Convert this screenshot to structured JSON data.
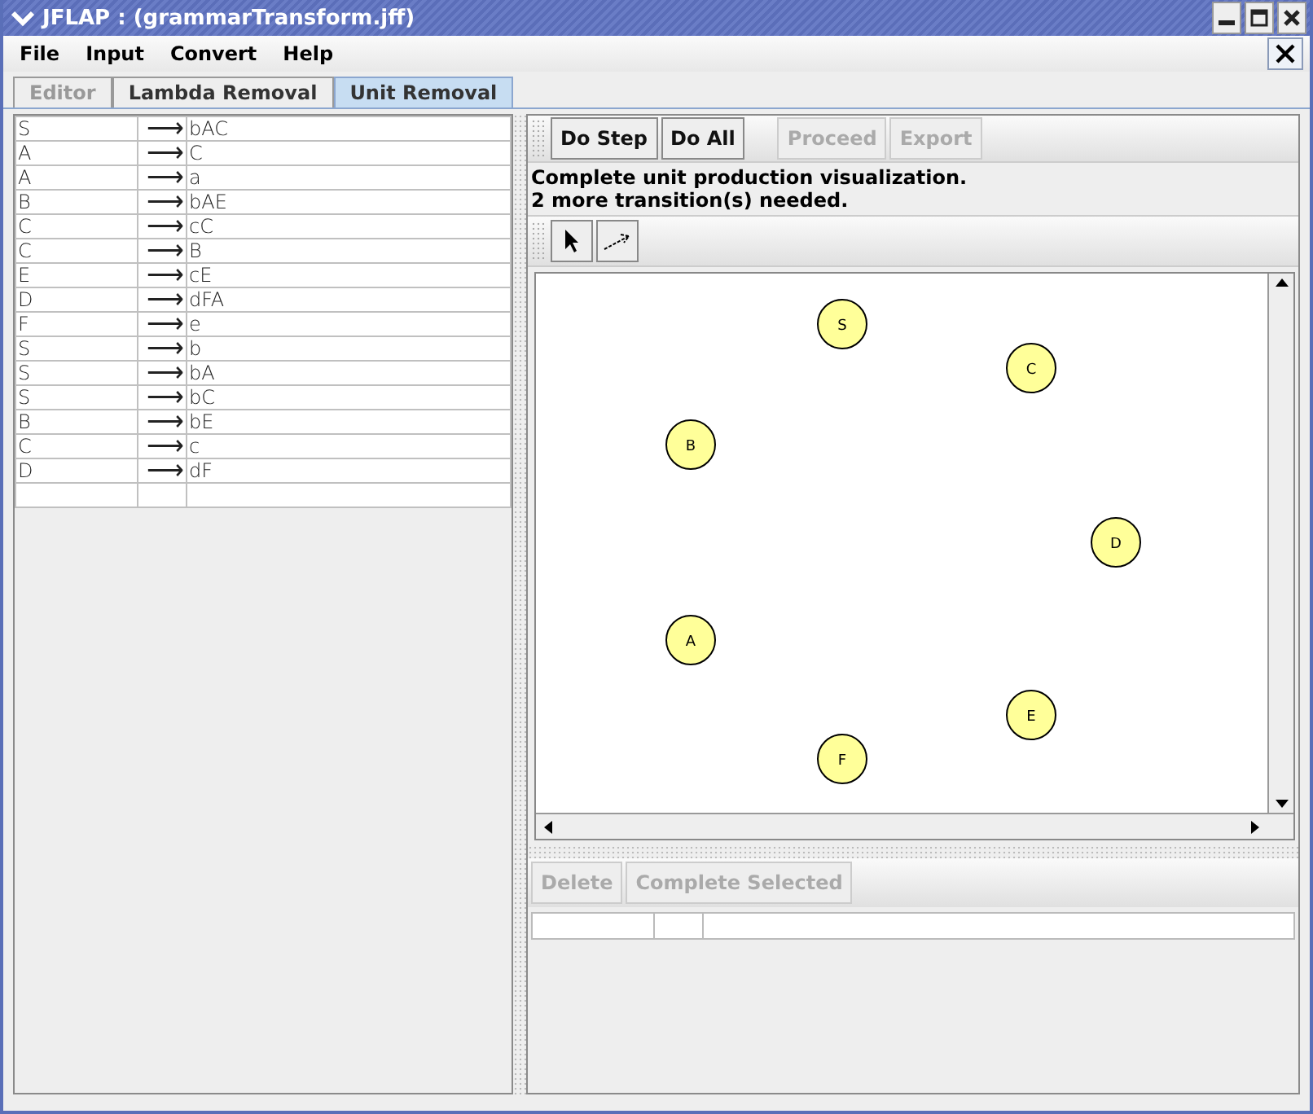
{
  "window": {
    "title": "JFLAP : (grammarTransform.jff)"
  },
  "menu": [
    "File",
    "Input",
    "Convert",
    "Help"
  ],
  "tabs": [
    {
      "label": "Editor",
      "selected": false,
      "disabled": true
    },
    {
      "label": "Lambda Removal",
      "selected": false,
      "disabled": false
    },
    {
      "label": "Unit Removal",
      "selected": true,
      "disabled": false
    }
  ],
  "productions": [
    {
      "lhs": "S",
      "arrow": "⟶",
      "rhs": "bAC"
    },
    {
      "lhs": "A",
      "arrow": "⟶",
      "rhs": "C"
    },
    {
      "lhs": "A",
      "arrow": "⟶",
      "rhs": "a"
    },
    {
      "lhs": "B",
      "arrow": "⟶",
      "rhs": "bAE"
    },
    {
      "lhs": "C",
      "arrow": "⟶",
      "rhs": "cC"
    },
    {
      "lhs": "C",
      "arrow": "⟶",
      "rhs": "B"
    },
    {
      "lhs": "E",
      "arrow": "⟶",
      "rhs": "cE"
    },
    {
      "lhs": "D",
      "arrow": "⟶",
      "rhs": "dFA"
    },
    {
      "lhs": "F",
      "arrow": "⟶",
      "rhs": "e"
    },
    {
      "lhs": "S",
      "arrow": "⟶",
      "rhs": "b"
    },
    {
      "lhs": "S",
      "arrow": "⟶",
      "rhs": "bA"
    },
    {
      "lhs": "S",
      "arrow": "⟶",
      "rhs": "bC"
    },
    {
      "lhs": "B",
      "arrow": "⟶",
      "rhs": "bE"
    },
    {
      "lhs": "C",
      "arrow": "⟶",
      "rhs": "c"
    },
    {
      "lhs": "D",
      "arrow": "⟶",
      "rhs": "dF"
    }
  ],
  "actions": [
    {
      "label": "Do Step",
      "disabled": false
    },
    {
      "label": "Do All",
      "disabled": false
    },
    {
      "label": "Proceed",
      "disabled": true
    },
    {
      "label": "Export",
      "disabled": true
    }
  ],
  "status": [
    "Complete unit production visualization.",
    "2 more transition(s) needed."
  ],
  "tools": [
    {
      "kind": "pointer",
      "selected": false
    },
    {
      "kind": "transition",
      "selected": false
    }
  ],
  "states": [
    "S",
    "C",
    "B",
    "D",
    "A",
    "E",
    "F"
  ],
  "bottom_buttons": [
    {
      "label": "Delete",
      "disabled": true
    },
    {
      "label": "Complete Selected",
      "disabled": true
    }
  ]
}
